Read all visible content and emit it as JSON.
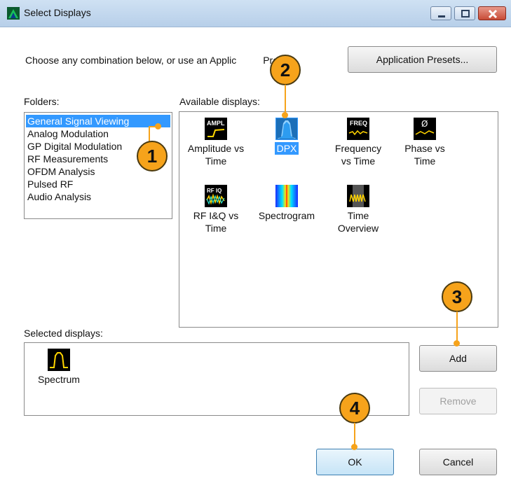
{
  "window": {
    "title": "Select Displays",
    "controls": [
      "minimize",
      "maximize",
      "close"
    ]
  },
  "prompt": "Choose any combination below, or use an Applic",
  "prompt_tail": "Preset.",
  "buttons": {
    "application_presets": "Application Presets...",
    "add": "Add",
    "remove": "Remove",
    "ok": "OK",
    "cancel": "Cancel"
  },
  "folders": {
    "label": "Folders:",
    "items": [
      "General Signal Viewing",
      "Analog Modulation",
      "GP Digital Modulation",
      "RF Measurements",
      "OFDM Analysis",
      "Pulsed RF",
      "Audio Analysis"
    ],
    "selected": "General Signal Viewing"
  },
  "available": {
    "label": "Available displays:",
    "items": [
      {
        "caption": "Amplitude vs Time",
        "line1": "Amplitude vs",
        "line2": "Time",
        "icon": "ampl-icon",
        "icon_text": "AMPL"
      },
      {
        "caption": "DPX",
        "line1": "DPX",
        "line2": "",
        "icon": "dpx-icon",
        "selected": true
      },
      {
        "caption": "Frequency vs Time",
        "line1": "Frequency",
        "line2": "vs Time",
        "icon": "freq-icon",
        "icon_text": "FREQ"
      },
      {
        "caption": "Phase vs Time",
        "line1": "Phase vs",
        "line2": "Time",
        "icon": "phase-icon",
        "icon_text": "Ø"
      },
      {
        "caption": "RF I&Q vs Time",
        "line1": "RF I&Q vs",
        "line2": "Time",
        "icon": "rfiq-icon",
        "icon_text": "RF IQ"
      },
      {
        "caption": "Spectrogram",
        "line1": "Spectrogram",
        "line2": "",
        "icon": "spectrogram-icon"
      },
      {
        "caption": "Time Overview",
        "line1": "Time",
        "line2": "Overview",
        "icon": "time-overview-icon"
      }
    ]
  },
  "selected_displays": {
    "label": "Selected displays:",
    "items": [
      {
        "caption": "Spectrum",
        "icon": "spectrum-icon"
      }
    ]
  },
  "callouts": [
    "1",
    "2",
    "3",
    "4"
  ],
  "colors": {
    "callout": "#f6a31b",
    "selection": "#3399ff",
    "titlebar": "#c4d8ee"
  }
}
